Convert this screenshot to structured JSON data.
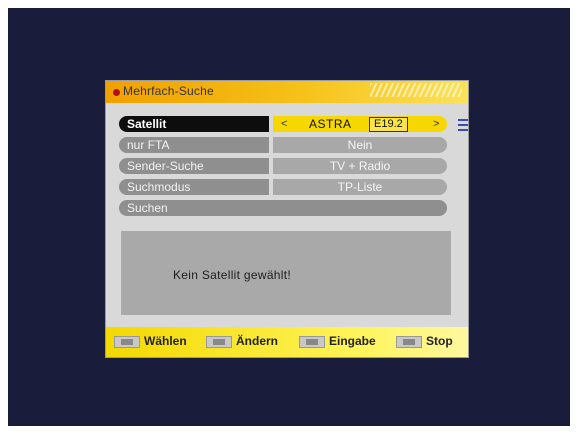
{
  "window": {
    "title": "Mehrfach-Suche"
  },
  "settings": {
    "rows": [
      {
        "label": "Satellit",
        "value": "ASTRA",
        "position": "E19.2",
        "active": true
      },
      {
        "label": "nur FTA",
        "value": "Nein"
      },
      {
        "label": "Sender-Suche",
        "value": "TV + Radio"
      },
      {
        "label": "Suchmodus",
        "value": "TP-Liste"
      },
      {
        "label": "Suchen"
      }
    ]
  },
  "message": {
    "text": "Kein Satellit gewählt!"
  },
  "footer": {
    "hints": [
      {
        "label": "Wählen",
        "icon": "up-down-key-icon"
      },
      {
        "label": "Ändern",
        "icon": "left-right-key-icon"
      },
      {
        "label": "Eingabe",
        "icon": "ok-key-icon"
      },
      {
        "label": "Stop",
        "icon": "exit-key-icon"
      }
    ]
  },
  "colors": {
    "header": "#f6c21a",
    "highlight": "#f6d800",
    "footer": "#fff45a",
    "tv_background": "#1a1c3b"
  }
}
